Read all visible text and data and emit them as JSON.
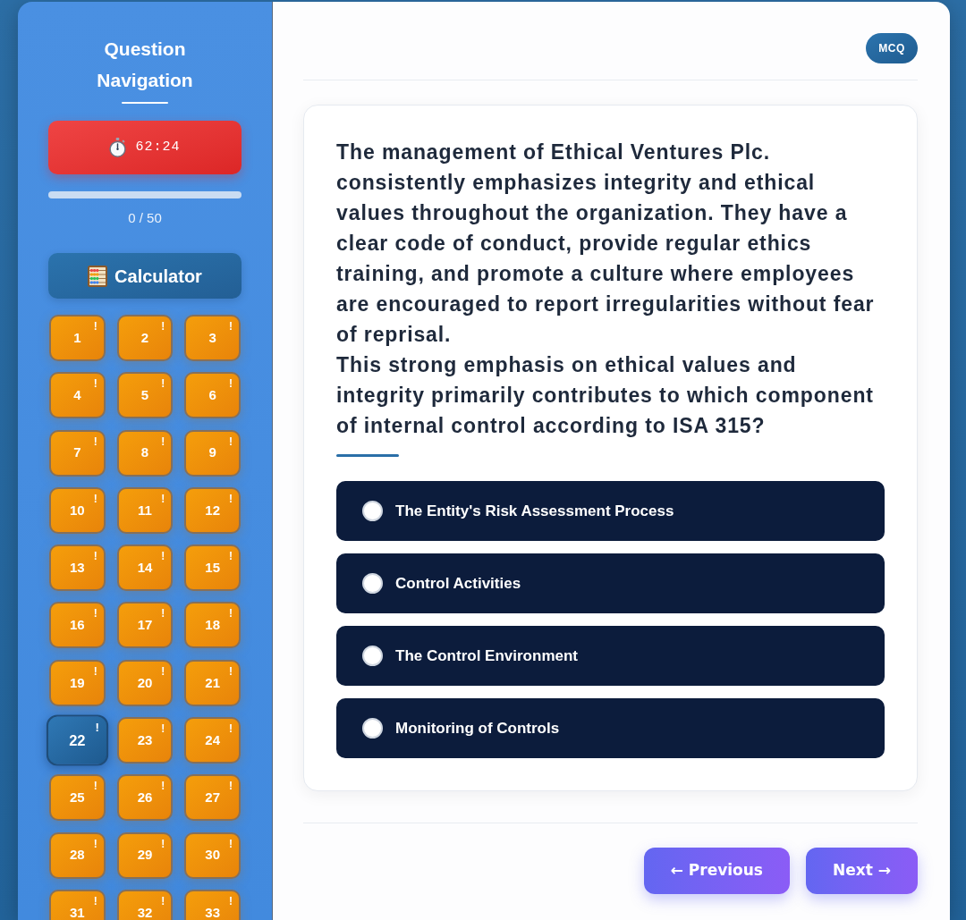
{
  "sidebar": {
    "title": "Question Navigation",
    "timer": {
      "text": "62:24"
    },
    "progress": {
      "level": 0,
      "text": "0 / 50"
    },
    "calculator_button": {
      "label": "Calculator"
    },
    "questions": [
      {
        "number": "1",
        "flag": "!",
        "selected": false
      },
      {
        "number": "2",
        "flag": "!",
        "selected": false
      },
      {
        "number": "3",
        "flag": "!",
        "selected": false
      },
      {
        "number": "4",
        "flag": "!",
        "selected": false
      },
      {
        "number": "5",
        "flag": "!",
        "selected": false
      },
      {
        "number": "6",
        "flag": "!",
        "selected": false
      },
      {
        "number": "7",
        "flag": "!",
        "selected": false
      },
      {
        "number": "8",
        "flag": "!",
        "selected": false
      },
      {
        "number": "9",
        "flag": "!",
        "selected": false
      },
      {
        "number": "10",
        "flag": "!",
        "selected": false
      },
      {
        "number": "11",
        "flag": "!",
        "selected": false
      },
      {
        "number": "12",
        "flag": "!",
        "selected": false
      },
      {
        "number": "13",
        "flag": "!",
        "selected": false
      },
      {
        "number": "14",
        "flag": "!",
        "selected": false
      },
      {
        "number": "15",
        "flag": "!",
        "selected": false
      },
      {
        "number": "16",
        "flag": "!",
        "selected": false
      },
      {
        "number": "17",
        "flag": "!",
        "selected": false
      },
      {
        "number": "18",
        "flag": "!",
        "selected": false
      },
      {
        "number": "19",
        "flag": "!",
        "selected": false
      },
      {
        "number": "20",
        "flag": "!",
        "selected": false
      },
      {
        "number": "21",
        "flag": "!",
        "selected": false
      },
      {
        "number": "22",
        "flag": "!",
        "selected": true
      },
      {
        "number": "23",
        "flag": "!",
        "selected": false
      },
      {
        "number": "24",
        "flag": "!",
        "selected": false
      },
      {
        "number": "25",
        "flag": "!",
        "selected": false
      },
      {
        "number": "26",
        "flag": "!",
        "selected": false
      },
      {
        "number": "27",
        "flag": "!",
        "selected": false
      },
      {
        "number": "28",
        "flag": "!",
        "selected": false
      },
      {
        "number": "29",
        "flag": "!",
        "selected": false
      },
      {
        "number": "30",
        "flag": "!",
        "selected": false
      },
      {
        "number": "31",
        "flag": "!",
        "selected": false
      },
      {
        "number": "32",
        "flag": "!",
        "selected": false
      },
      {
        "number": "33",
        "flag": "!",
        "selected": false
      }
    ]
  },
  "main": {
    "badge": "MCQ",
    "question": [
      "The management of Ethical Ventures Plc. consistently emphasizes integrity and ethical values throughout the organization. They have a clear code of conduct, provide regular ethics training, and promote a culture where employees are encouraged to report irregularities without fear of reprisal.",
      "This strong emphasis on ethical values and integrity primarily contributes to which component of internal control according to ISA 315?"
    ],
    "options": [
      {
        "label": "The Entity's Risk Assessment Process",
        "selected": false
      },
      {
        "label": "Control Activities",
        "selected": false
      },
      {
        "label": "The Control Environment",
        "selected": false
      },
      {
        "label": "Monitoring of Controls",
        "selected": false
      }
    ],
    "buttons": [
      "← Previous",
      "Next →"
    ]
  }
}
